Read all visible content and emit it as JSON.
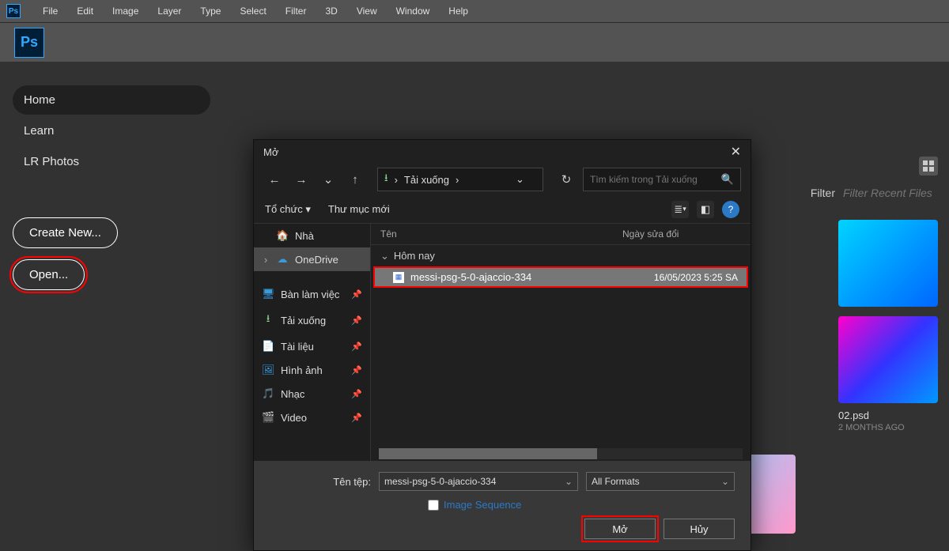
{
  "menubar": {
    "items": [
      "File",
      "Edit",
      "Image",
      "Layer",
      "Type",
      "Select",
      "Filter",
      "3D",
      "View",
      "Window",
      "Help"
    ]
  },
  "leftnav": {
    "home": "Home",
    "learn": "Learn",
    "lrphotos": "LR Photos",
    "create_new": "Create New...",
    "open": "Open..."
  },
  "filter": {
    "label": "Filter",
    "placeholder": "Filter Recent Files"
  },
  "recent_tiles": [
    {
      "name": "",
      "date": ""
    },
    {
      "name": "02.psd",
      "date": "2 MONTHS AGO"
    }
  ],
  "dialog": {
    "title": "Mở",
    "breadcrumb_loc": "Tải xuống",
    "search_placeholder": "Tìm kiếm trong Tải xuống",
    "toolbar": {
      "organize": "Tổ chức",
      "newfolder": "Thư mục mới"
    },
    "tree": [
      {
        "label": "Nhà",
        "icon": "🏠",
        "chev": ""
      },
      {
        "label": "OneDrive",
        "icon": "☁",
        "chev": "›",
        "selected": true,
        "cloud": true
      },
      {
        "label": "Bàn làm việc",
        "icon": "🖥",
        "chev": "",
        "pin": true,
        "blue": true
      },
      {
        "label": "Tải xuống",
        "icon": "↓",
        "chev": "",
        "pin": true,
        "green": true
      },
      {
        "label": "Tài liệu",
        "icon": "📄",
        "chev": "",
        "pin": true,
        "blue": true
      },
      {
        "label": "Hình ảnh",
        "icon": "🖼",
        "chev": "",
        "pin": true,
        "blue": true
      },
      {
        "label": "Nhạc",
        "icon": "🎵",
        "chev": "",
        "pin": true,
        "red": true
      },
      {
        "label": "Video",
        "icon": "🎬",
        "chev": "",
        "pin": true,
        "purple": true
      }
    ],
    "columns": {
      "name": "Tên",
      "date": "Ngày sửa đổi"
    },
    "group": "Hôm nay",
    "file": {
      "name": "messi-psg-5-0-ajaccio-334",
      "date": "16/05/2023 5:25 SA"
    },
    "footer": {
      "filename_label": "Tên tệp:",
      "filename_value": "messi-psg-5-0-ajaccio-334",
      "format": "All Formats",
      "image_sequence": "Image Sequence",
      "open_btn": "Mở",
      "cancel_btn": "Hủy"
    }
  }
}
